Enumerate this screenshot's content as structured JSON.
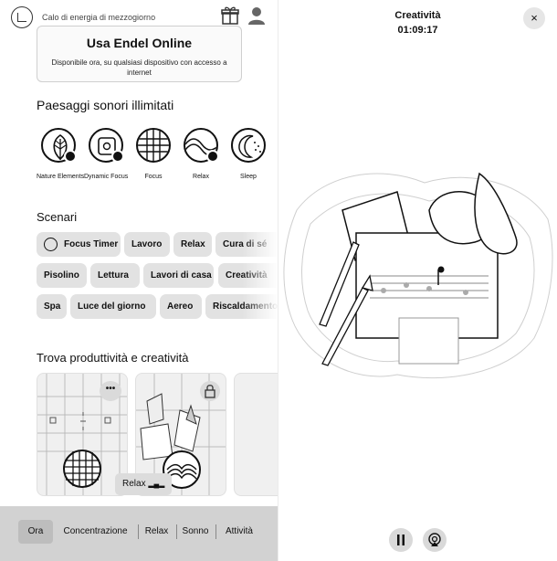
{
  "header": {
    "subtitle": "Calo di energia di mezzogiorno",
    "top_icon": "arrow-icon",
    "gift_icon": "gift-icon",
    "user_icon": "user-icon"
  },
  "promo": {
    "title": "Usa Endel Online",
    "subtitle": "Disponibile ora, su qualsiasi dispositivo con accesso a internet"
  },
  "soundscapes": {
    "title": "Paesaggi sonori illimitati",
    "items": [
      {
        "label": "Nature Elements",
        "icon": "leaf-icon",
        "locked": true
      },
      {
        "label": "Dynamic Focus",
        "icon": "speaker-icon",
        "locked": true
      },
      {
        "label": "Focus",
        "icon": "grid-icon",
        "locked": false
      },
      {
        "label": "Relax",
        "icon": "wave-icon",
        "locked": true
      },
      {
        "label": "Sleep",
        "icon": "moon-icon",
        "locked": false
      }
    ]
  },
  "scenarios": {
    "title": "Scenari",
    "chips": [
      "Focus Timer",
      "Lavoro",
      "Relax",
      "Cura di sé",
      "Pisolino",
      "Lettura",
      "Lavori di casa",
      "Creatività",
      "Spa",
      "Luce del giorno",
      "Aereo",
      "Riscaldamento"
    ]
  },
  "productivity": {
    "title": "Trova produttività e creatività",
    "more_label": "•••",
    "relax_pill": "Relax"
  },
  "nav": {
    "tabs": [
      "Ora",
      "Concentrazione",
      "Relax",
      "Sonno",
      "Attività"
    ],
    "active": "Ora"
  },
  "player": {
    "title": "Creatività",
    "time": "01:09:17",
    "close_label": "×",
    "pause_icon": "pause-icon",
    "airplay_icon": "airplay-icon"
  },
  "colors": {
    "accent": "#1c1c1c",
    "chip_bg": "#e2e2e2",
    "nav_bg": "#d2d2d2"
  }
}
